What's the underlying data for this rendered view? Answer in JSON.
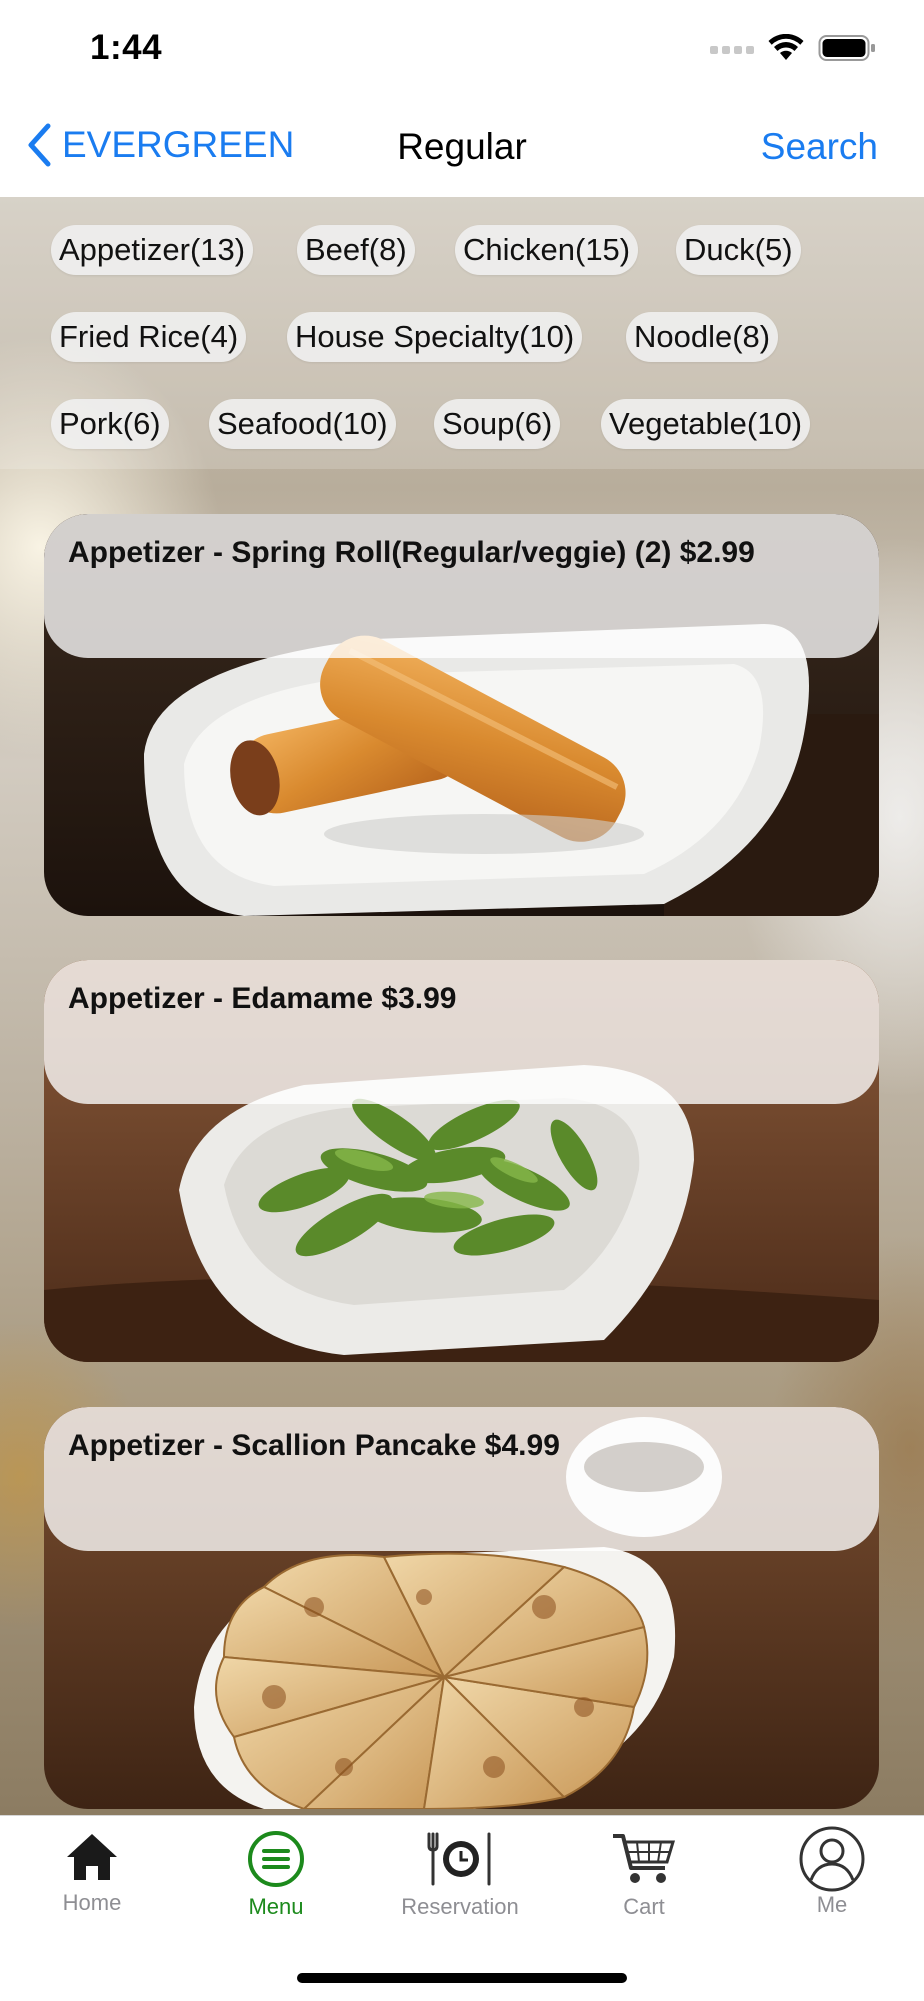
{
  "status_bar": {
    "time": "1:44"
  },
  "nav": {
    "back_label": "EVERGREEN",
    "title": "Regular",
    "search_label": "Search"
  },
  "categories": [
    "Appetizer(13)",
    "Beef(8)",
    "Chicken(15)",
    "Duck(5)",
    "Fried Rice(4)",
    "House Specialty(10)",
    "Noodle(8)",
    "Pork(6)",
    "Seafood(10)",
    "Soup(6)",
    "Vegetable(10)"
  ],
  "menu_items": [
    {
      "caption": "Appetizer - Spring Roll(Regular/veggie) (2)  $2.99",
      "image": "spring-roll-photo"
    },
    {
      "caption": "Appetizer - Edamame  $3.99",
      "image": "edamame-photo"
    },
    {
      "caption": "Appetizer - Scallion Pancake  $4.99",
      "image": "scallion-pancake-photo"
    }
  ],
  "tabs": [
    {
      "label": "Home",
      "icon": "home-icon"
    },
    {
      "label": "Menu",
      "icon": "menu-icon",
      "active": true
    },
    {
      "label": "Reservation",
      "icon": "reservation-icon"
    },
    {
      "label": "Cart",
      "icon": "cart-icon"
    },
    {
      "label": "Me",
      "icon": "profile-icon"
    }
  ],
  "colors": {
    "accent": "#1a7cf0",
    "active_tab": "#1c8a1c",
    "inactive_tab": "#8e8e93"
  }
}
